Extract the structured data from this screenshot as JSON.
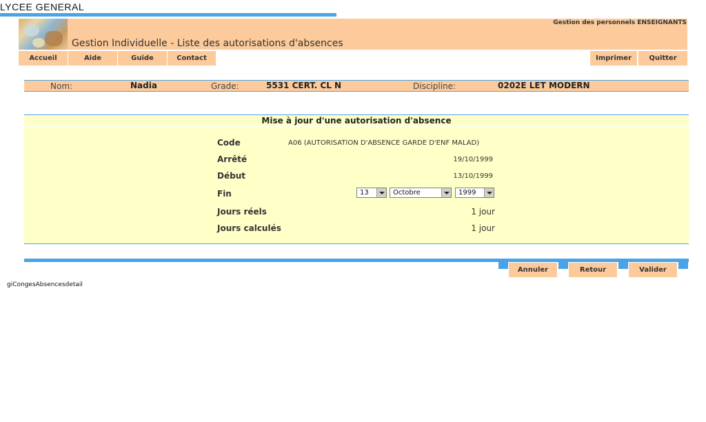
{
  "top": {
    "title": "LYCEE GENERAL"
  },
  "header": {
    "subtitle": "Gestion des personnels ENSEIGNANTS",
    "page_title": "Gestion Individuelle - Liste des autorisations d'absences"
  },
  "nav": {
    "left": [
      "Accueil",
      "Aide",
      "Guide",
      "Contact"
    ],
    "right": [
      "Imprimer",
      "Quitter"
    ]
  },
  "info": {
    "nom_label": "Nom:",
    "nom_value": "Nadia",
    "grade_label": "Grade:",
    "grade_value": "5531 CERT. CL N",
    "discipline_label": "Discipline:",
    "discipline_value": "0202E LET MODERN"
  },
  "panel": {
    "title": "Mise à jour d'une autorisation d'absence",
    "fields": {
      "code_label": "Code",
      "code_value": "A06 (AUTORISATION D'ABSENCE GARDE D'ENF MALAD)",
      "arrete_label": "Arrêté",
      "arrete_value": "19/10/1999",
      "debut_label": "Début",
      "debut_value": "13/10/1999",
      "fin_label": "Fin",
      "fin_day": "13",
      "fin_month": "Octobre",
      "fin_year": "1999",
      "jours_reels_label": "Jours réels",
      "jours_reels_value": "1 jour",
      "jours_calcules_label": "Jours calculés",
      "jours_calcules_value": "1 jour"
    }
  },
  "actions": {
    "annuler": "Annuler",
    "retour": "Retour",
    "valider": "Valider"
  },
  "footer": {
    "page_id": "giCongesAbsencesdetail"
  },
  "colors": {
    "peach": "#fdcb9b",
    "blue": "#4aa3e6",
    "panel_yellow": "#ffffc8"
  }
}
